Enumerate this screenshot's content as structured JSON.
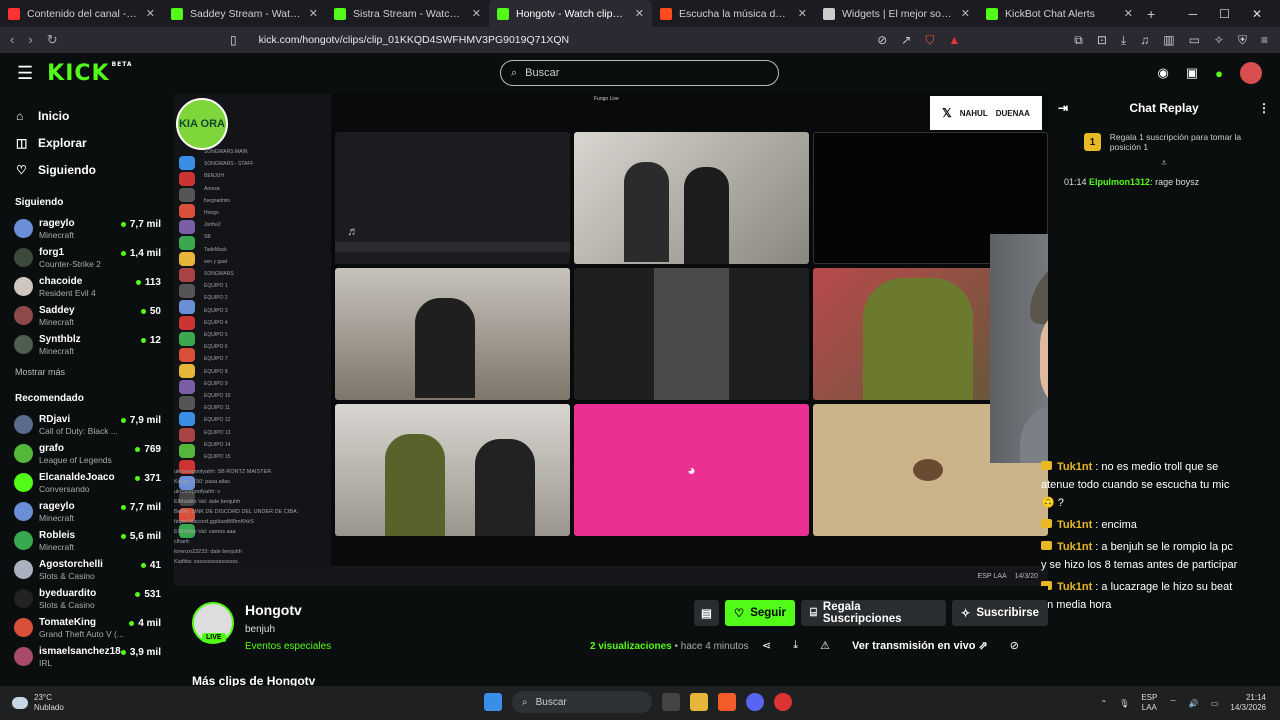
{
  "browser": {
    "tabs": [
      {
        "title": "Contenido del canal - YouTube Studio",
        "color": "#ff3333"
      },
      {
        "title": "Saddey Stream - Watch Live on Kick",
        "color": "#53fc18"
      },
      {
        "title": "Sistra Stream - Watch Live on Kick",
        "color": "#53fc18"
      },
      {
        "title": "Hongotv - Watch clips on Kick",
        "color": "#53fc18",
        "active": true
      },
      {
        "title": "Escucha la música de Sistracks | Disfruta",
        "color": "#ff4c1f"
      },
      {
        "title": "Widgets | El mejor software para podcast",
        "color": "#cccccc"
      },
      {
        "title": "KickBot Chat Alerts",
        "color": "#53fc18"
      }
    ],
    "new_tab": "+",
    "url": "kick.com/hongotv/clips/clip_01KKQD4SWFHMV3PG9019Q71XQN"
  },
  "header": {
    "logo": "KICK",
    "logo_badge": "BETA",
    "search_placeholder": "Buscar"
  },
  "sidebar": {
    "nav": [
      {
        "label": "Inicio",
        "icon": "home-icon",
        "glyph": "⌂"
      },
      {
        "label": "Explorar",
        "icon": "compass-icon",
        "glyph": "◫"
      },
      {
        "label": "Siguiendo",
        "icon": "heart-icon",
        "glyph": "♡"
      }
    ],
    "following_title": "Siguiendo",
    "following": [
      {
        "name": "rageylo",
        "game": "Minecraft",
        "viewers": "7,7 mil",
        "color": "#6b8fd6"
      },
      {
        "name": "forg1",
        "game": "Counter-Strike 2",
        "viewers": "1,4 mil",
        "color": "#3c4a3c"
      },
      {
        "name": "chacoide",
        "game": "Resident Evil 4",
        "viewers": "113",
        "color": "#cfc6c0"
      },
      {
        "name": "Saddey",
        "game": "Minecraft",
        "viewers": "50",
        "color": "#8c4a4a"
      },
      {
        "name": "Synthblz",
        "game": "Minecraft",
        "viewers": "12",
        "color": "#4f5d4f"
      }
    ],
    "show_more": "Mostrar más",
    "recommended_title": "Recomendado",
    "recommended": [
      {
        "name": "RDjavi",
        "game": "Call of Duty: Black ...",
        "viewers": "7,9 mil",
        "color": "#5b6b8c"
      },
      {
        "name": "grafo",
        "game": "League of Legends",
        "viewers": "769",
        "color": "#53b83a"
      },
      {
        "name": "ElcanaldeJoaco",
        "game": "Conversando",
        "viewers": "371",
        "color": "#53fc18"
      },
      {
        "name": "rageylo",
        "game": "Minecraft",
        "viewers": "7,7 mil",
        "color": "#6b8fd6"
      },
      {
        "name": "Robleis",
        "game": "Minecraft",
        "viewers": "5,6 mil",
        "color": "#3aa84f"
      },
      {
        "name": "Agostorchelli",
        "game": "Slots & Casino",
        "viewers": "41",
        "color": "#aab2c0"
      },
      {
        "name": "byeduardito",
        "game": "Slots & Casino",
        "viewers": "531",
        "color": "#222222"
      },
      {
        "name": "TomateKing",
        "game": "Grand Theft Auto V (...",
        "viewers": "4 mil",
        "color": "#d94f3a"
      },
      {
        "name": "ismaelsanchez18",
        "game": "IRL",
        "viewers": "3,9 mil",
        "color": "#a84a6b"
      }
    ]
  },
  "video": {
    "server_name": "KIA ORA",
    "top_label": "Fungo Live",
    "sponsor_left": "NAHUL",
    "sponsor_right": "DUENAA",
    "discord_rows": [
      "SONGWARS MAIN",
      "SONGWARS - STAFF",
      "BENJUH",
      "Aressa",
      "fuegoadmin",
      "Hongo",
      "Jorthe2",
      "SB",
      "TadeMack",
      "zen y gaat",
      "SONGWARS",
      "EQUIPO 1",
      "EQUIPO 2",
      "EQUIPO 3",
      "EQUIPO 4",
      "EQUIPO 5",
      "EQUIPO 6",
      "EQUIPO 7",
      "EQUIPO 8",
      "EQUIPO 9",
      "EQUIPO 10",
      "EQUIPO 11",
      "EQUIPO 12",
      "EQUIPO 13",
      "EQUIPO 14",
      "EQUIPO 15"
    ],
    "overlay_chat": [
      "ukroewgoofyahh: SB RONTZ MAISTER",
      "Kogga_150: pasa ailas",
      "ukroewgoofyahh: v",
      "ElMaldito Val: dale benjuhh",
      "BeiRs: LINK DE DISCORD DEL UNDER DE CIBA:",
      "https://discord.gg/dardM9mKhkS",
      "ElMaldito Val: vamos aaa",
      "clharit:",
      "lorenzo23233: dale benjuhh",
      "Kiafitta: ssssssssssssssss",
      "Elpulmon1312: rage boysz"
    ],
    "tray_lang": "ESP LAA",
    "tray_time": "14/3/20"
  },
  "chat": {
    "title": "Chat Replay",
    "gift_badge": "1",
    "gift_text": "Regala 1 suscripción para tomar la posición 1",
    "first": {
      "time": "01:14",
      "user": "Elpulmon1312",
      "text": "rage boysz"
    },
    "messages": [
      {
        "user": "Tuk1nt",
        "text": "no es medio troll que se atenue todo cuando se escucha tu mic 🙃 ?"
      },
      {
        "user": "Tuk1nt",
        "text": "encima"
      },
      {
        "user": "Tuk1nt",
        "text": "a benjuh se le rompio la pc y se hizo los 8 temas antes de participar"
      },
      {
        "user": "Tuk1nt",
        "text": "a lucazrage le hizo su beat en media hora"
      }
    ]
  },
  "info": {
    "channel": "Hongotv",
    "live": "LIVE",
    "title": "benjuh",
    "category": "Eventos especiales",
    "follow": "Seguir",
    "gift_subs": "Regala Suscripciones",
    "subscribe": "Suscribirse",
    "views_count": "2",
    "views_label": "visualizaciones",
    "ago": "• hace 4 minutos",
    "watch_live": "Ver transmisión en vivo",
    "more_clips": "Más clips de Hongotv"
  },
  "taskbar": {
    "temp": "23°C",
    "weather": "Nublado",
    "search": "Buscar",
    "lang1": "ESP",
    "lang2": "LAA",
    "time": "21:14",
    "date": "14/3/2026"
  }
}
